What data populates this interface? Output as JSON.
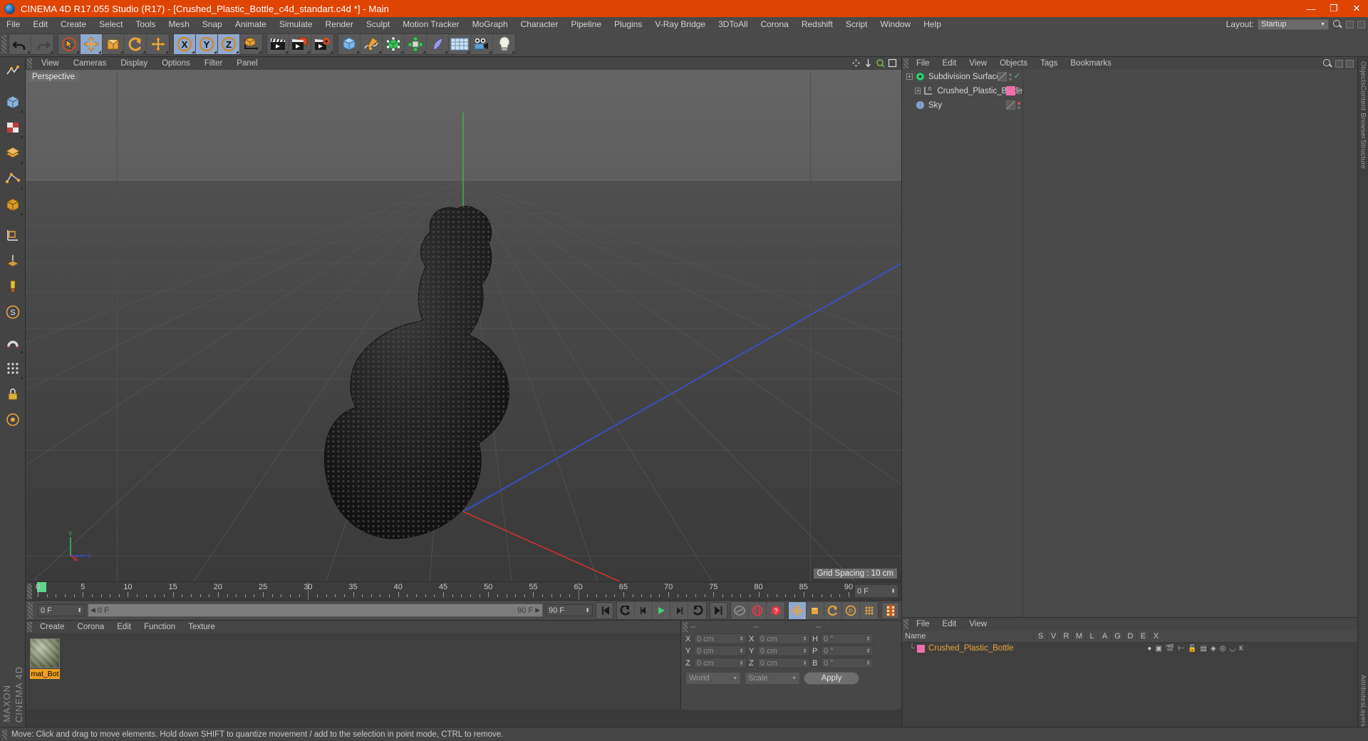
{
  "window": {
    "title": "CINEMA 4D R17.055 Studio (R17) - [Crushed_Plastic_Bottle_c4d_standart.c4d *] - Main",
    "minimize": "—",
    "maximize": "❐",
    "close": "✕",
    "accent_color": "#e04403"
  },
  "menubar": {
    "items": [
      "File",
      "Edit",
      "Create",
      "Select",
      "Tools",
      "Mesh",
      "Snap",
      "Animate",
      "Simulate",
      "Render",
      "Sculpt",
      "Motion Tracker",
      "MoGraph",
      "Character",
      "Pipeline",
      "Plugins",
      "V-Ray Bridge",
      "3DToAll",
      "Corona",
      "Redshift",
      "Script",
      "Window",
      "Help"
    ],
    "layout_label": "Layout:",
    "layout_value": "Startup",
    "search_icon": "search-icon"
  },
  "toolbar": {
    "groups": [
      {
        "name": "undo-redo",
        "buttons": [
          {
            "name": "undo-button",
            "icon": "undo-arrow",
            "selected": false
          },
          {
            "name": "redo-button",
            "icon": "redo-arrow",
            "selected": false
          }
        ]
      },
      {
        "name": "transform-tools",
        "buttons": [
          {
            "name": "live-selection-tool",
            "icon": "cursor-circle",
            "selected": false
          },
          {
            "name": "move-tool",
            "icon": "move-arrows",
            "selected": true
          },
          {
            "name": "scale-tool",
            "icon": "scale-box",
            "selected": false
          },
          {
            "name": "rotate-tool",
            "icon": "rotate-circle",
            "selected": false
          },
          {
            "name": "move-duplicate-tool",
            "icon": "move-arrows",
            "selected": false
          }
        ]
      },
      {
        "name": "axis-locks",
        "buttons": [
          {
            "name": "lock-x-axis",
            "icon": "x-axis",
            "selected": true
          },
          {
            "name": "lock-y-axis",
            "icon": "y-axis",
            "selected": true
          },
          {
            "name": "lock-z-axis",
            "icon": "z-axis",
            "selected": true
          },
          {
            "name": "world-coordinate-toggle",
            "icon": "world-axis-cube",
            "selected": false
          }
        ]
      },
      {
        "name": "render-tools",
        "buttons": [
          {
            "name": "render-view-button",
            "icon": "clapperboard",
            "selected": false
          },
          {
            "name": "render-to-picture-viewer-button",
            "icon": "clapperboard-picture",
            "selected": false
          },
          {
            "name": "render-settings-button",
            "icon": "clapperboard-gear",
            "selected": false
          }
        ]
      },
      {
        "name": "object-creation",
        "buttons": [
          {
            "name": "add-cube-button",
            "icon": "cube",
            "selected": false
          },
          {
            "name": "add-spline-button",
            "icon": "pen-spline",
            "selected": false
          },
          {
            "name": "add-generator-button",
            "icon": "generator-cube",
            "selected": false
          },
          {
            "name": "add-mograph-button",
            "icon": "cloner-array",
            "selected": false
          },
          {
            "name": "add-deformer-button",
            "icon": "bend-deformer",
            "selected": false
          },
          {
            "name": "add-environment-button",
            "icon": "floor-grid",
            "selected": false
          },
          {
            "name": "add-camera-button",
            "icon": "camera",
            "selected": false
          },
          {
            "name": "add-light-button",
            "icon": "lightbulb",
            "selected": false
          }
        ]
      }
    ]
  },
  "leftbar": {
    "buttons": [
      {
        "name": "make-editable-button",
        "icon": "make-editable"
      },
      {
        "name": "model-mode-button",
        "icon": "model-box"
      },
      {
        "name": "texture-mode-button",
        "icon": "texture-checker"
      },
      {
        "name": "polygon-mode-button",
        "icon": "polygon-layers"
      },
      {
        "name": "point-mode-button",
        "icon": "point-mode"
      },
      {
        "name": "edge-mode-button",
        "icon": "edge-mode"
      },
      {
        "name": "object-axis-button",
        "icon": "object-axis-box"
      },
      {
        "name": "workplane-button",
        "icon": "workplane-corner"
      },
      {
        "name": "paint-tool-button",
        "icon": "paint-brush"
      },
      {
        "name": "sculpt-symmetry-button",
        "icon": "sculpt-s"
      },
      {
        "name": "enable-snap-button",
        "icon": "magnet"
      },
      {
        "name": "quantize-button",
        "icon": "quantize-grid"
      },
      {
        "name": "lock-axis-button",
        "icon": "lock"
      },
      {
        "name": "viewport-solo-button",
        "icon": "solo-circle"
      }
    ]
  },
  "viewport": {
    "menu": [
      "View",
      "Cameras",
      "Display",
      "Options",
      "Filter",
      "Panel"
    ],
    "label": "Perspective",
    "grid_spacing": "Grid Spacing : 10 cm",
    "axis_labels": {
      "x": "X",
      "y": "Y",
      "z": "Z"
    },
    "header_icons": [
      "pan-icon",
      "move-icon",
      "zoom-icon",
      "maximize-viewport-icon"
    ]
  },
  "timeline": {
    "ticks": [
      0,
      5,
      10,
      15,
      20,
      25,
      30,
      35,
      40,
      45,
      50,
      55,
      60,
      65,
      70,
      75,
      80,
      85,
      90
    ],
    "current_frame_box": "0 F",
    "start_frame": "0 F",
    "end_frame": "90 F",
    "preview_min": "0 F",
    "preview_max": "90 F",
    "playhead_frame": 0
  },
  "playback": {
    "buttons": [
      {
        "name": "go-to-start-button",
        "icon": "skip-start"
      },
      {
        "name": "previous-key-button",
        "icon": "prev-key"
      },
      {
        "name": "step-back-button",
        "icon": "step-back"
      },
      {
        "name": "play-button",
        "icon": "play"
      },
      {
        "name": "step-forward-button",
        "icon": "step-forward"
      },
      {
        "name": "next-key-button",
        "icon": "next-key"
      },
      {
        "name": "go-to-end-button",
        "icon": "skip-end"
      },
      {
        "name": "record-active-objects-button",
        "icon": "key-record"
      },
      {
        "name": "autokeying-button",
        "icon": "autokey-circle"
      },
      {
        "name": "keyframe-selection-button",
        "icon": "key-question"
      }
    ],
    "record_toggles": [
      {
        "name": "record-position-button",
        "icon": "move-arrows",
        "selected": true
      },
      {
        "name": "record-scale-button",
        "icon": "scale-box",
        "selected": false
      },
      {
        "name": "record-rotation-button",
        "icon": "rotate-circle",
        "selected": false
      },
      {
        "name": "record-parameter-button",
        "icon": "p-circle",
        "selected": false
      },
      {
        "name": "record-pla-button",
        "icon": "point-dots",
        "selected": false
      }
    ],
    "filmstrip": {
      "name": "timeline-filmstrip-button",
      "icon": "filmstrip",
      "selected": true
    }
  },
  "material_manager": {
    "menu": [
      "Create",
      "Corona",
      "Edit",
      "Function",
      "Texture"
    ],
    "materials": [
      {
        "name": "mat_Bot",
        "selected": true
      }
    ]
  },
  "coordinates": {
    "header": [
      "--",
      "--",
      "--"
    ],
    "rows": [
      {
        "label1": "X",
        "value1": "0 cm",
        "label2": "X",
        "value2": "0 cm",
        "label3": "H",
        "value3": "0 °"
      },
      {
        "label1": "Y",
        "value1": "0 cm",
        "label2": "Y",
        "value2": "0 cm",
        "label3": "P",
        "value3": "0 °"
      },
      {
        "label1": "Z",
        "value1": "0 cm",
        "label2": "Z",
        "value2": "0 cm",
        "label3": "B",
        "value3": "0 °"
      }
    ],
    "system": "World",
    "mode": "Scale",
    "apply": "Apply"
  },
  "object_manager": {
    "menu": [
      "File",
      "Edit",
      "View",
      "Objects",
      "Tags",
      "Bookmarks"
    ],
    "objects": [
      {
        "name": "Subdivision Surface",
        "icon": "subdivision-surface-icon",
        "indent": 0,
        "has_expander": true,
        "tag_type": "disabled",
        "dot_state": "check",
        "selected": false
      },
      {
        "name": "Crushed_Plastic_Bottle",
        "icon": "polygon-object-icon",
        "indent": 1,
        "has_expander": true,
        "tag_type": "pink",
        "dot_state": "normal",
        "selected": false
      },
      {
        "name": "Sky",
        "icon": "sky-icon",
        "indent": 0,
        "has_expander": false,
        "tag_type": "disabled",
        "dot_state": "red",
        "selected": false
      }
    ]
  },
  "bottom_manager": {
    "menu": [
      "File",
      "Edit",
      "View"
    ],
    "columns": [
      "Name",
      "S",
      "V",
      "R",
      "M",
      "L",
      "A",
      "G",
      "D",
      "E",
      "X"
    ],
    "rows": [
      {
        "name": "Crushed_Plastic_Bottle",
        "swatch": "#f06ea9",
        "selected": true
      }
    ]
  },
  "statusbar": {
    "text": "Move: Click and drag to move elements. Hold down SHIFT to quantize movement / add to the selection in point mode, CTRL to remove."
  },
  "right_tabs": [
    "Objects",
    "Content Browser",
    "Structure"
  ],
  "right_tabs_lower": [
    "Attributes",
    "Layers"
  ],
  "brand": {
    "line1": "MAXON",
    "line2": "CINEMA 4D"
  },
  "colors": {
    "accent": "#e04403",
    "selection_blue": "#8fa8cc",
    "material_label": "#f0a020",
    "pink_tag": "#f06ea9",
    "green_play": "#3fd07a"
  }
}
